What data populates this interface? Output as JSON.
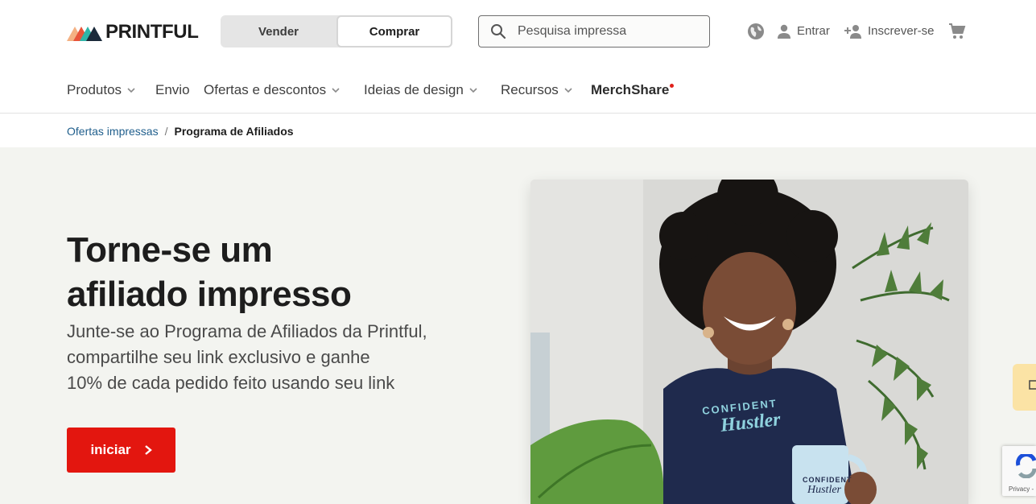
{
  "header": {
    "logo_text": "PRINTFUL",
    "toggle": {
      "sell": "Vender",
      "buy": "Comprar",
      "active": "buy"
    },
    "search": {
      "placeholder": "Pesquisa impressa",
      "value": ""
    },
    "sign_in": "Entrar",
    "sign_up": "Inscrever-se",
    "icons": {
      "search": "search-icon",
      "language": "globe-icon",
      "sign_in": "user-icon",
      "sign_up": "add-user-icon",
      "cart": "cart-icon"
    }
  },
  "nav": {
    "items": [
      {
        "label": "Produtos",
        "dropdown": true
      },
      {
        "label": "Envio",
        "dropdown": false
      },
      {
        "label": "Ofertas e descontos",
        "dropdown": true
      },
      {
        "label": "Ideias de design",
        "dropdown": true
      },
      {
        "label": "Recursos",
        "dropdown": true
      },
      {
        "label": "MerchShare",
        "dropdown": false,
        "badge_dot": true
      }
    ]
  },
  "breadcrumb": {
    "parent": "Ofertas impressas",
    "separator": "/",
    "current": "Programa de Afiliados"
  },
  "hero": {
    "title_line1": "Torne-se um",
    "title_line2": "afiliado impresso",
    "subtitle_line1": "Junte-se ao Programa de Afiliados da Printful,",
    "subtitle_line2": "compartilhe seu link exclusivo e ganhe",
    "subtitle_line3": "10% de cada pedido feito usando seu link",
    "cta_label": "iniciar",
    "image_shirt_text_1": "CONFIDENT",
    "image_shirt_text_2": "Hustler"
  },
  "recaptcha": {
    "label": "Privacy -"
  },
  "colors": {
    "brand_red": "#e3160f",
    "hero_bg": "#f3f4f0",
    "link_blue": "#1f5e8c",
    "notification_dot": "#e0211b",
    "side_tab": "#fbe3a5"
  }
}
